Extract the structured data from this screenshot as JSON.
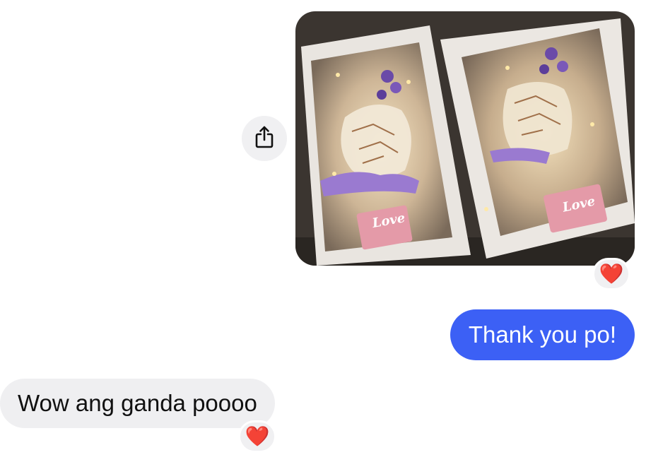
{
  "conversation": {
    "messages": [
      {
        "type": "image",
        "side": "outgoing",
        "reaction": "❤️"
      },
      {
        "type": "text",
        "side": "outgoing",
        "text": "Thank you po!"
      },
      {
        "type": "text",
        "side": "incoming",
        "text": "Wow ang ganda poooo",
        "reaction": "❤️"
      }
    ],
    "share_icon": "share-icon"
  },
  "image_content": {
    "card_text": "Love"
  },
  "colors": {
    "outgoing_bubble": "#3c60f5",
    "incoming_bubble": "#efeff1",
    "reaction_background": "#f0f0f2"
  }
}
